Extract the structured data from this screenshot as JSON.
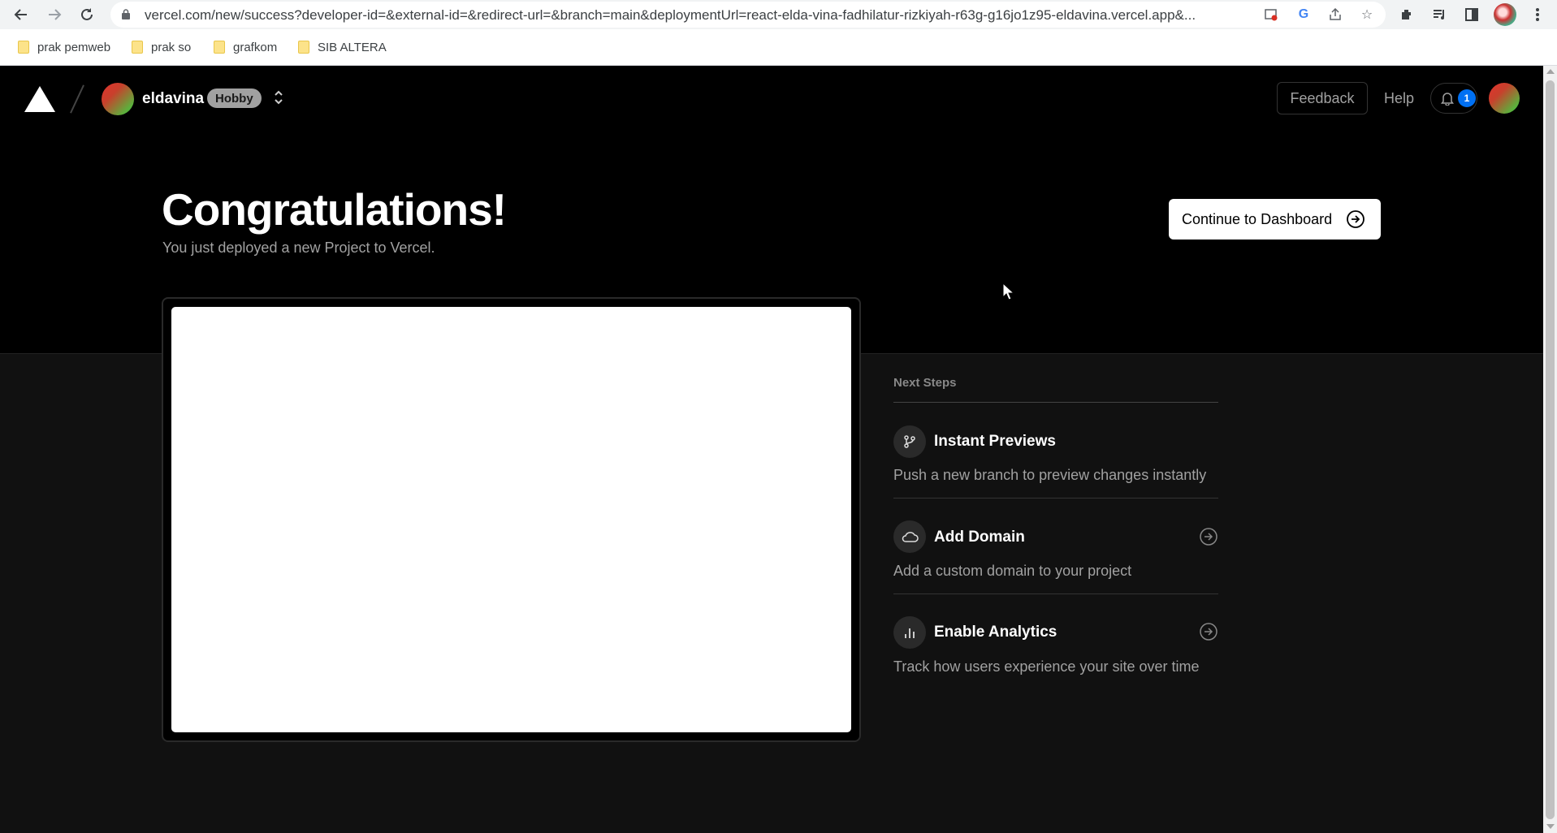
{
  "browser": {
    "url": "vercel.com/new/success?developer-id=&external-id=&redirect-url=&branch=main&deploymentUrl=react-elda-vina-fadhilatur-rizkiyah-r63g-g16jo1z95-eldavina.vercel.app&...",
    "bookmarks": [
      {
        "label": "prak pemweb"
      },
      {
        "label": "prak so"
      },
      {
        "label": "grafkom"
      },
      {
        "label": "SIB ALTERA"
      }
    ]
  },
  "header": {
    "team_name": "eldavina",
    "plan": "Hobby",
    "feedback_label": "Feedback",
    "help_label": "Help",
    "notification_count": "1"
  },
  "hero": {
    "title": "Congratulations!",
    "subtitle": "You just deployed a new Project to Vercel.",
    "dashboard_button": "Continue to Dashboard"
  },
  "next_steps": {
    "title": "Next Steps",
    "items": [
      {
        "title": "Instant Previews",
        "description": "Push a new branch to preview changes instantly",
        "icon": "git-branch-icon"
      },
      {
        "title": "Add Domain",
        "description": "Add a custom domain to your project",
        "icon": "cloud-icon"
      },
      {
        "title": "Enable Analytics",
        "description": "Track how users experience your site over time",
        "icon": "bar-chart-icon"
      }
    ]
  }
}
